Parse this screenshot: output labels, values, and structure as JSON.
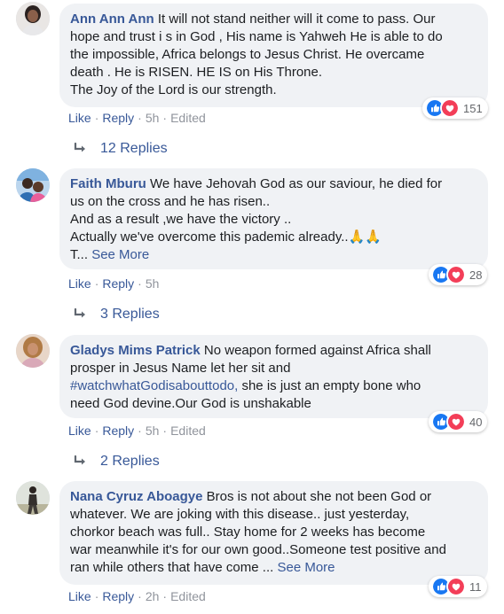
{
  "comments": [
    {
      "author": "Ann Ann Ann",
      "lines": [
        "It will not stand neither will it come to pass. Our",
        "hope and trust i s in God , His name is Yahweh He is able to do",
        "the impossible, Africa belongs to Jesus Christ. He overcame",
        "death . He is RISEN. HE IS on His Throne.",
        "The Joy of the Lord is our strength."
      ],
      "reaction_count": "151",
      "like": "Like",
      "reply": "Reply",
      "time": "5h",
      "edited": "Edited",
      "replies": "12 Replies"
    },
    {
      "author": "Faith Mburu",
      "lines": [
        "We have Jehovah God as our saviour, he died for",
        "us on the cross and he has risen..",
        "And as a result ,we have the victory ..",
        "Actually we've overcome this pademic already..🙏🙏",
        "T..."
      ],
      "see_more": "See More",
      "reaction_count": "28",
      "like": "Like",
      "reply": "Reply",
      "time": "5h",
      "replies": "3 Replies"
    },
    {
      "author": "Gladys Mims Patrick",
      "lines": [
        "No weapon formed against Africa shall",
        "prosper in Jesus Name let her sit and",
        "she is just an empty bone who",
        "need God devine.Our God is unshakable"
      ],
      "hashtag": "#watchwhatGodisabouttodo,",
      "reaction_count": "40",
      "like": "Like",
      "reply": "Reply",
      "time": "5h",
      "edited": "Edited",
      "replies": "2 Replies"
    },
    {
      "author": "Nana Cyruz Aboagye",
      "lines": [
        "Bros is not about she not been God or",
        "whatever. We are joking with this disease.. just yesterday,",
        "chorkor beach was full.. Stay home for 2 weeks has become",
        "war meanwhile it's for our own good..Someone test positive and",
        "ran while others that have come ..."
      ],
      "see_more": "See More",
      "reaction_count": "11",
      "like": "Like",
      "reply": "Reply",
      "time": "2h",
      "edited": "Edited"
    }
  ],
  "colors": {
    "link": "#385898",
    "bubble": "#f0f2f5",
    "like_blue": "#1877f2",
    "love_red": "#f33e58"
  }
}
